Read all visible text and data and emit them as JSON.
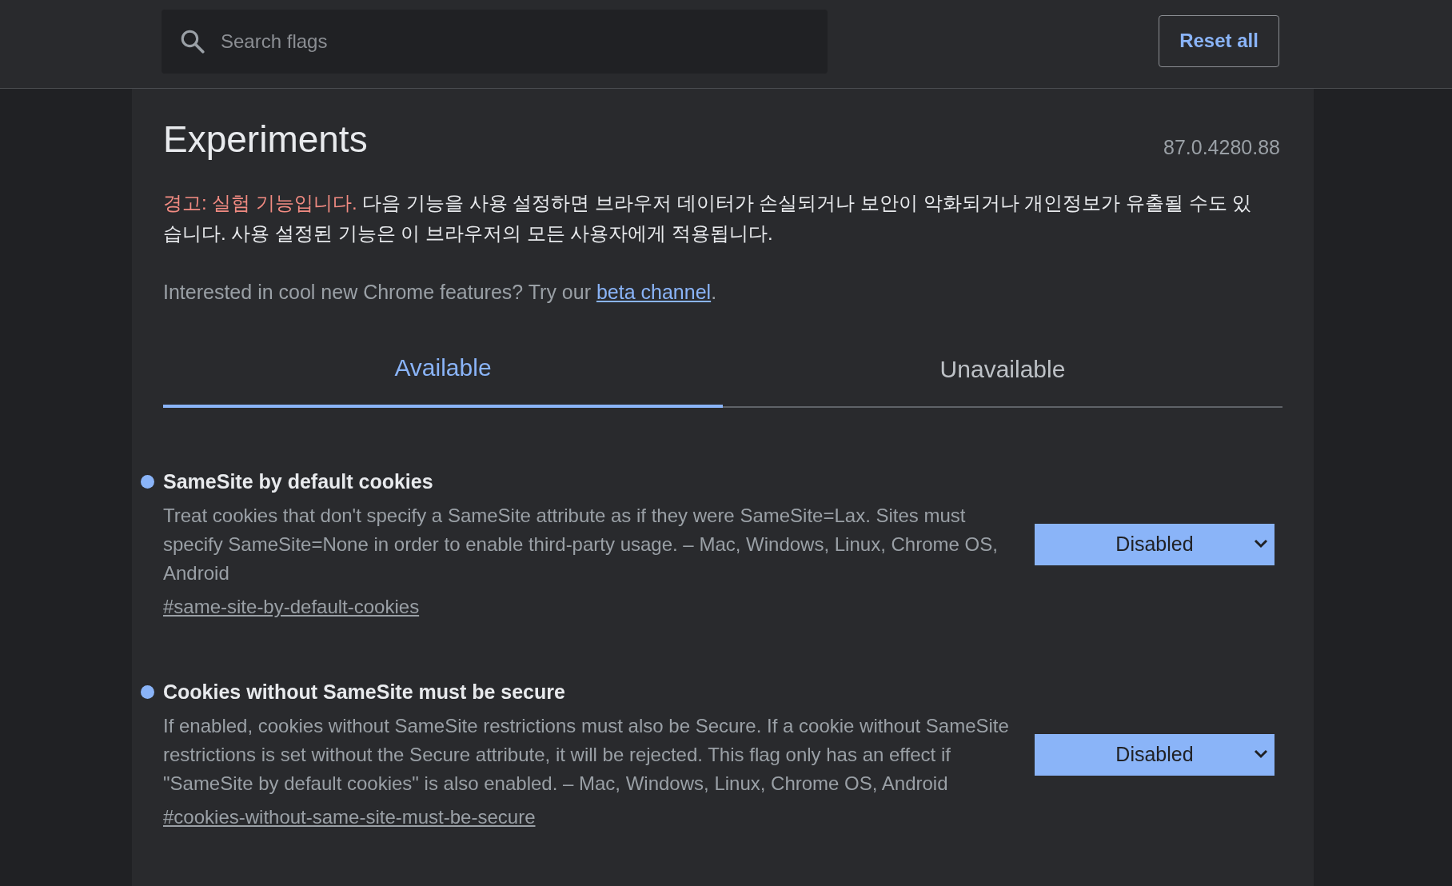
{
  "search": {
    "placeholder": "Search flags"
  },
  "reset_button": "Reset all",
  "title": "Experiments",
  "version": "87.0.4280.88",
  "warning": {
    "label": "경고: 실험 기능입니다.",
    "text": "다음 기능을 사용 설정하면 브라우저 데이터가 손실되거나 보안이 악화되거나 개인정보가 유출될 수도 있습니다. 사용 설정된 기능은 이 브라우저의 모든 사용자에게 적용됩니다."
  },
  "promo": {
    "text": "Interested in cool new Chrome features? Try our",
    "link": "beta channel",
    "end": "."
  },
  "tabs": [
    {
      "label": "Available",
      "selected": true
    },
    {
      "label": "Unavailable",
      "selected": false
    }
  ],
  "flags": [
    {
      "title": "SameSite by default cookies",
      "description": "Treat cookies that don't specify a SameSite attribute as if they were SameSite=Lax. Sites must specify SameSite=None in order to enable third-party usage. – Mac, Windows, Linux, Chrome OS, Android",
      "link": "#same-site-by-default-cookies",
      "value": "Disabled"
    },
    {
      "title": "Cookies without SameSite must be secure",
      "description": "If enabled, cookies without SameSite restrictions must also be Secure. If a cookie without SameSite restrictions is set without the Secure attribute, it will be rejected. This flag only has an effect if \"SameSite by default cookies\" is also enabled. – Mac, Windows, Linux, Chrome OS, Android",
      "link": "#cookies-without-same-site-must-be-secure",
      "value": "Disabled"
    }
  ]
}
